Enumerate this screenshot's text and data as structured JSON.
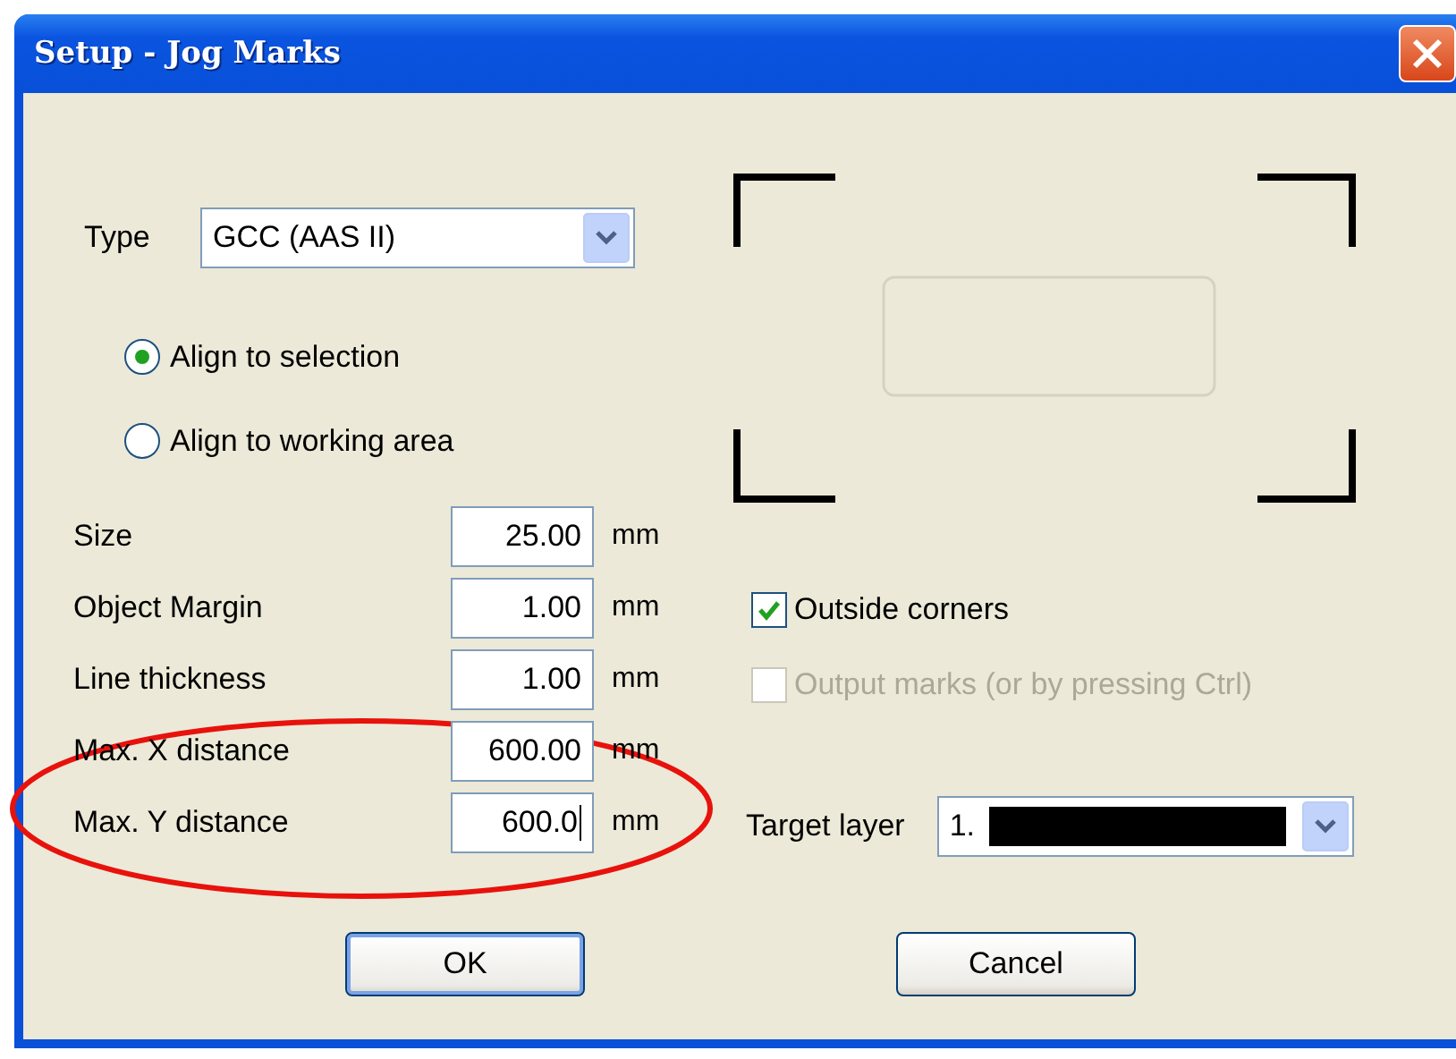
{
  "window": {
    "title": "Setup - Jog Marks"
  },
  "type_field": {
    "label": "Type",
    "value": "GCC (AAS II)"
  },
  "align_options": [
    {
      "label": "Align to selection",
      "selected": true
    },
    {
      "label": "Align to working area",
      "selected": false
    }
  ],
  "fields": [
    {
      "label": "Size",
      "value": "25.00",
      "unit": "mm",
      "caret": false
    },
    {
      "label": "Object Margin",
      "value": "1.00",
      "unit": "mm",
      "caret": false
    },
    {
      "label": "Line thickness",
      "value": "1.00",
      "unit": "mm",
      "caret": false
    },
    {
      "label": "Max. X distance",
      "value": "600.00",
      "unit": "mm",
      "caret": false
    },
    {
      "label": "Max. Y distance",
      "value": "600.0",
      "unit": "mm",
      "caret": true
    }
  ],
  "checkboxes": [
    {
      "label": "Outside corners",
      "checked": true,
      "disabled": false
    },
    {
      "label": "Output marks (or by pressing Ctrl)",
      "checked": false,
      "disabled": true
    }
  ],
  "target_layer": {
    "label": "Target layer",
    "value": "1.",
    "redacted": true
  },
  "buttons": [
    {
      "label": "OK",
      "default": true
    },
    {
      "label": "Cancel",
      "default": false
    }
  ],
  "annotation": {
    "kind": "ellipse"
  }
}
